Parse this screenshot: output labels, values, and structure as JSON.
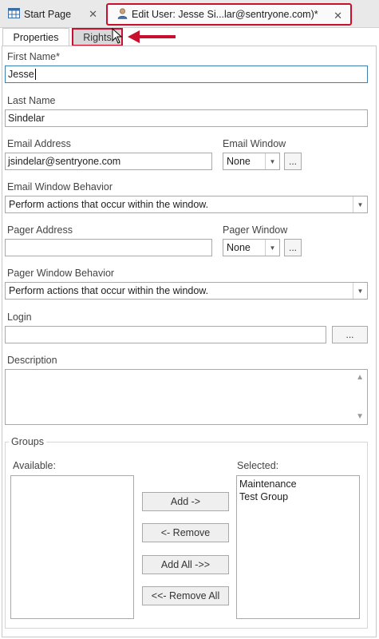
{
  "tabs": {
    "start_page": "Start Page",
    "edit_user": "Edit User: Jesse Si...lar@sentryone.com)*"
  },
  "subtabs": {
    "properties": "Properties",
    "rights": "Rights"
  },
  "form": {
    "first_name_label": "First Name*",
    "first_name_value": "Jesse",
    "last_name_label": "Last Name",
    "last_name_value": "Sindelar",
    "email_address_label": "Email Address",
    "email_address_value": "jsindelar@sentryone.com",
    "email_window_label": "Email Window",
    "email_window_value": "None",
    "email_window_behavior_label": "Email Window Behavior",
    "email_window_behavior_value": "Perform actions that occur within the window.",
    "pager_address_label": "Pager Address",
    "pager_address_value": "",
    "pager_window_label": "Pager Window",
    "pager_window_value": "None",
    "pager_window_behavior_label": "Pager Window Behavior",
    "pager_window_behavior_value": "Perform actions that occur within the window.",
    "login_label": "Login",
    "login_value": "",
    "description_label": "Description",
    "description_value": "",
    "ellipsis": "..."
  },
  "groups": {
    "title": "Groups",
    "available_label": "Available:",
    "selected_label": "Selected:",
    "available_items": [],
    "selected_items": [
      "Maintenance",
      "Test Group"
    ],
    "add_button": "Add ->",
    "remove_button": "<- Remove",
    "add_all_button": "Add All ->>",
    "remove_all_button": "<<- Remove All"
  },
  "colors": {
    "highlight": "#c8102e",
    "focus_border": "#3c7fb1"
  }
}
